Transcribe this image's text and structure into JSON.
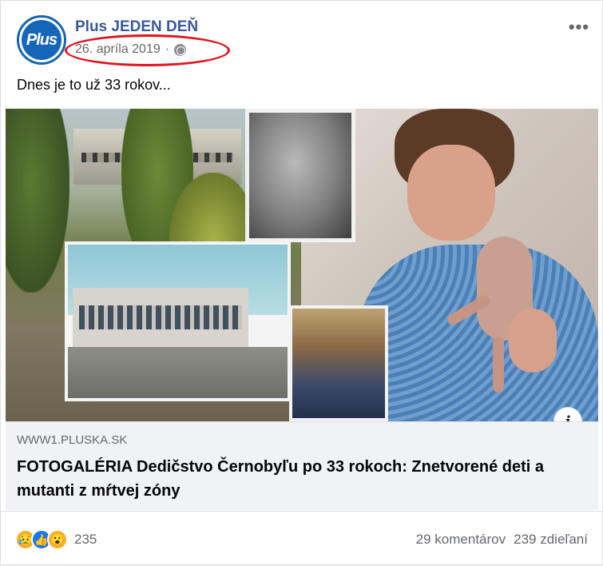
{
  "post": {
    "page_name": "Plus JEDEN DEŇ",
    "avatar_text": "Plus",
    "date": "26. apríla 2019",
    "separator": "·",
    "audience_icon": "globe-icon",
    "more_icon": "more-options-icon",
    "more_label": "•••",
    "text": "Dnes je to už 33 rokov..."
  },
  "link": {
    "info_icon": "info-icon",
    "info_label": "i",
    "domain": "WWW1.PLUSKA.SK",
    "title": "FOTOGALÉRIA Dedičstvo Černobyľu po 33 rokoch: Znetvorené deti a mutanti z mŕtvej zóny"
  },
  "footer": {
    "reaction_icons": [
      "sad-reaction-icon",
      "like-reaction-icon",
      "wow-reaction-icon"
    ],
    "reaction_glyphs": [
      "😥",
      "👍",
      "😮"
    ],
    "reaction_count": "235",
    "comments": "29 komentárov",
    "shares": "239 zdieľaní"
  },
  "colors": {
    "page_name": "#385898",
    "annotation_ring": "#e0141e",
    "like_blue": "#1877f2"
  }
}
